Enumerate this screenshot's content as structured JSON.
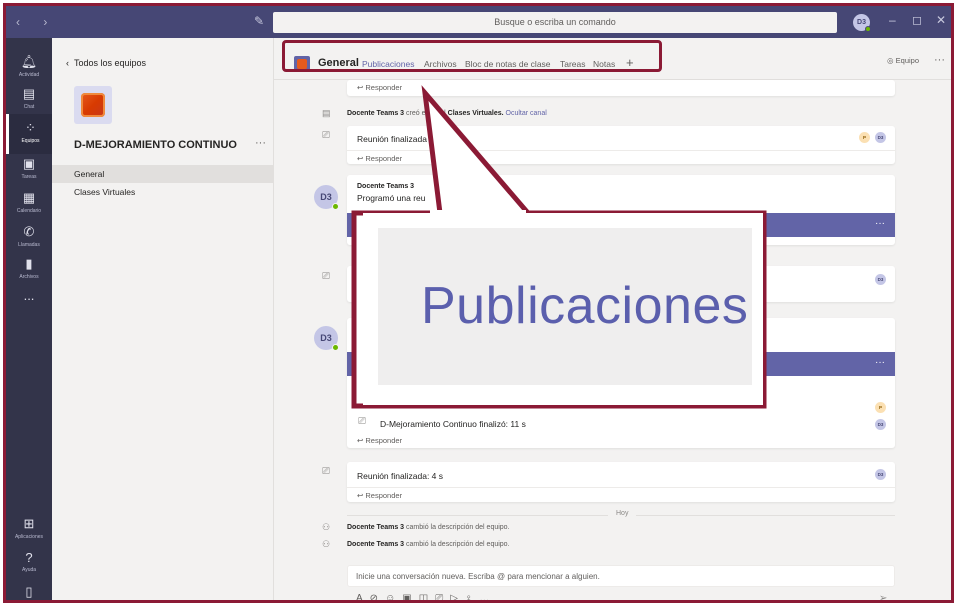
{
  "titlebar": {
    "search_placeholder": "Busque o escriba un comando",
    "user_initials": "D3"
  },
  "appbar": {
    "items": [
      {
        "label": "Actividad",
        "icon": "bell-icon"
      },
      {
        "label": "Chat",
        "icon": "chat-icon"
      },
      {
        "label": "Equipos",
        "icon": "teams-icon"
      },
      {
        "label": "Tareas",
        "icon": "assignments-icon"
      },
      {
        "label": "Calendario",
        "icon": "calendar-icon"
      },
      {
        "label": "Llamadas",
        "icon": "phone-icon"
      },
      {
        "label": "Archivos",
        "icon": "file-icon"
      },
      {
        "label": "...",
        "icon": "more-icon"
      },
      {
        "label": "Aplicaciones",
        "icon": "apps-icon"
      },
      {
        "label": "Ayuda",
        "icon": "help-icon"
      }
    ]
  },
  "teampane": {
    "back_label": "Todos los equipos",
    "team_name": "D-MEJORAMIENTO CONTINUO",
    "more": "···",
    "channels": [
      "General",
      "Clases Virtuales"
    ]
  },
  "header": {
    "channel": "General",
    "tabs": [
      "Publicaciones",
      "Archivos",
      "Bloc de notas de clase",
      "Tareas",
      "Notas"
    ],
    "add": "+",
    "team_button": "Equipo",
    "more": "···"
  },
  "posts": {
    "reply": "Responder",
    "sys1_author": "Docente Teams 3",
    "sys1_text": "creó el canal",
    "sys1_channel": "Clases Virtuales.",
    "sys1_link": "Ocultar canal",
    "meeting1": "Reunión finalizada",
    "post_author": "Docente Teams 3",
    "post_text": "Programó una reu",
    "avatar": "D3",
    "meeting2": "D-Mejoramiento Continuo finalizó: 11 s",
    "meeting3": "Reunión finalizada: 4 s",
    "day_divider": "Hoy",
    "sys2_author": "Docente Teams 3",
    "sys2_text": "cambió la descripción del equipo.",
    "sys3_author": "Docente Teams 3",
    "sys3_text": "cambió la descripción del equipo.",
    "mini_dd": "D3",
    "mini_p": "P"
  },
  "compose": {
    "placeholder": "Inicie una conversación nueva. Escriba @ para mencionar a alguien."
  },
  "zoom": {
    "text": "Publicaciones"
  },
  "colors": {
    "accent": "#6264a7",
    "titlebar": "#464775",
    "appbar": "#33344a",
    "callout": "#8b1a35"
  }
}
